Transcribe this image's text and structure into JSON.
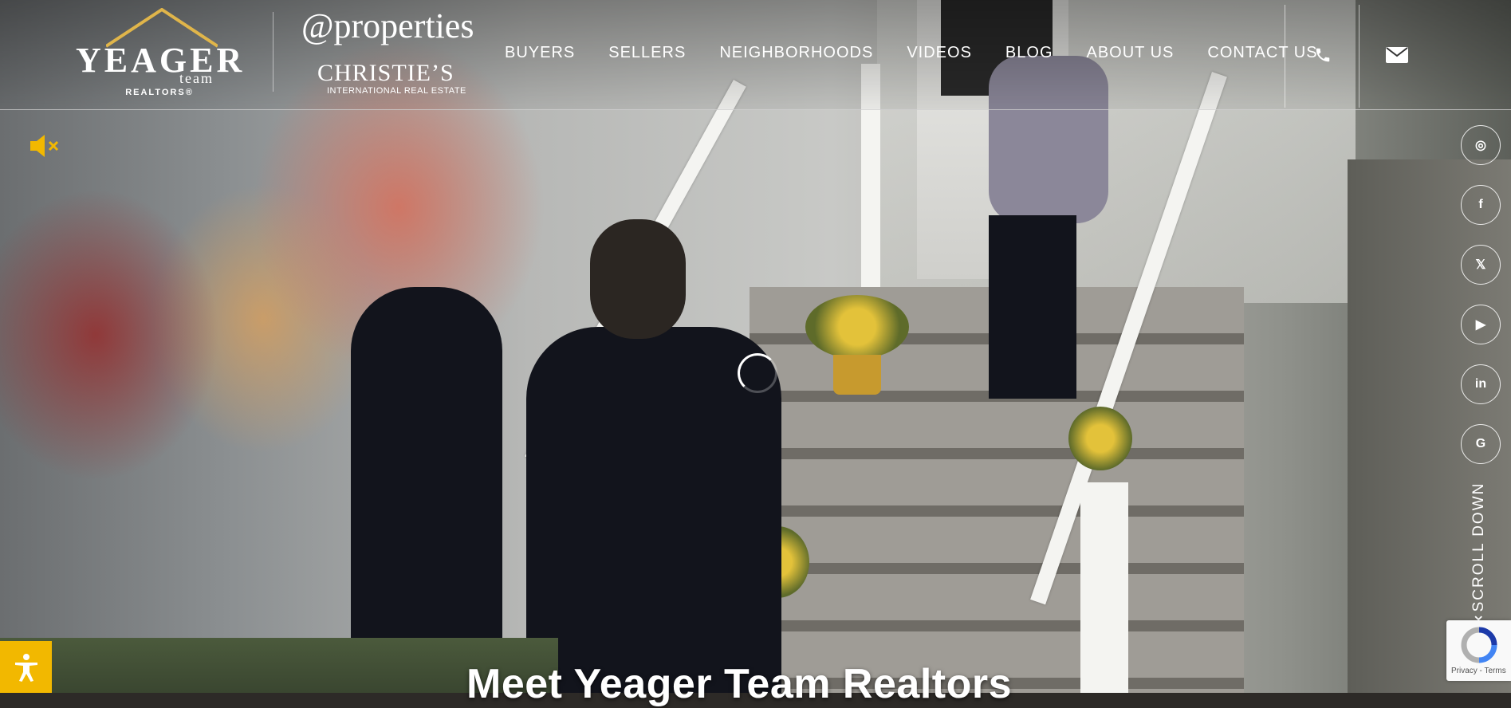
{
  "header": {
    "logo_yeager": {
      "word": "YEAGER",
      "team": "team",
      "sub": "REALTORS®"
    },
    "logo_properties": {
      "at": "@properties",
      "brand": "CHRISTIE’S",
      "sub": "INTERNATIONAL REAL ESTATE"
    }
  },
  "nav": {
    "items": [
      "BUYERS",
      "SELLERS",
      "NEIGHBORHOODS",
      "VIDEOS",
      "BLOG",
      "ABOUT US",
      "CONTACT US"
    ]
  },
  "contact": {
    "phone_icon": "phone-icon",
    "mail_icon": "mail-icon"
  },
  "video": {
    "caption": "Meet Yeager Team Realtors",
    "sound": "muted"
  },
  "social": [
    "instagram-icon",
    "facebook-icon",
    "x-icon",
    "youtube-icon",
    "linkedin-icon",
    "google-icon"
  ],
  "social_glyphs": [
    "◎",
    "f",
    "𝕏",
    "▶",
    "in",
    "G"
  ],
  "scroll": {
    "label": "SCROLL DOWN"
  },
  "recaptcha": {
    "text": "Privacy - Terms"
  },
  "colors": {
    "accent": "#f2b800",
    "nav_text": "#ffffff"
  }
}
